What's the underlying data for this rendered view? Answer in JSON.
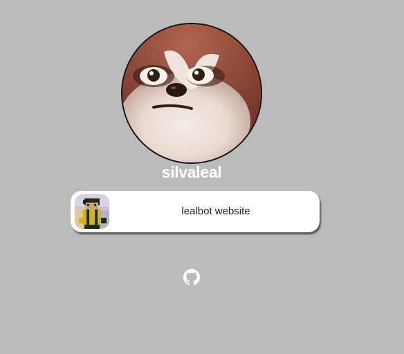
{
  "profile": {
    "username": "silvaleal",
    "avatar_icon": "red-panda-avatar"
  },
  "links": [
    {
      "label": "lealbot website",
      "thumbnail_icon": "blocky-character-thumbnail"
    }
  ],
  "social": {
    "github_icon": "github-icon"
  },
  "colors": {
    "background": "#bbbbbb",
    "card": "#ffffff",
    "username_text": "#ffffff",
    "icon": "#ffffff"
  }
}
